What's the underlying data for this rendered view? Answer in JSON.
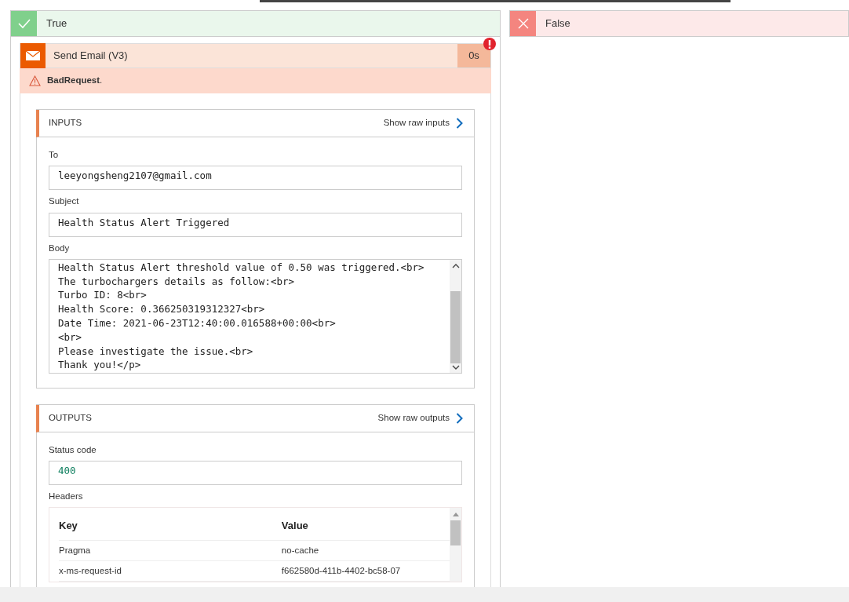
{
  "branches": [
    {
      "kind": "success",
      "label": "True",
      "actions": [
        {
          "title": "Send Email (V3)",
          "duration": "0s",
          "failed": true,
          "error": "**BadRequest**.",
          "sections": [
            {
              "title": "INPUTS",
              "link": "Show raw inputs",
              "fields": [
                {
                  "kind": "text",
                  "label": "To",
                  "value": "leeyongsheng2107@gmail.com"
                },
                {
                  "kind": "text",
                  "label": "Subject",
                  "value": "Health Status Alert Triggered"
                },
                {
                  "kind": "multiline",
                  "label": "Body",
                  "lines": [
                    "Health Status Alert threshold value of 0.50 was triggered.<br>",
                    "The turbochargers details as follow:<br>",
                    "Turbo ID: 8<br>",
                    "Health Score: 0.366250319312327<br>",
                    "Date Time: 2021-06-23T12:40:00.016588+00:00<br>",
                    "<br>",
                    "Please investigate the issue.<br>",
                    "Thank you!</p>"
                  ]
                }
              ]
            },
            {
              "title": "OUTPUTS",
              "link": "Show raw outputs",
              "fields": [
                {
                  "kind": "code",
                  "label": "Status code",
                  "value": "400"
                },
                {
                  "kind": "table",
                  "label": "Headers",
                  "columns": [
                    "Key",
                    "Value"
                  ],
                  "rows": [
                    [
                      "Pragma",
                      "no-cache"
                    ],
                    [
                      "x-ms-request-id",
                      "f662580d-411b-4402-bc58-07"
                    ]
                  ]
                }
              ]
            }
          ]
        }
      ]
    },
    {
      "kind": "failure",
      "label": "False"
    }
  ]
}
